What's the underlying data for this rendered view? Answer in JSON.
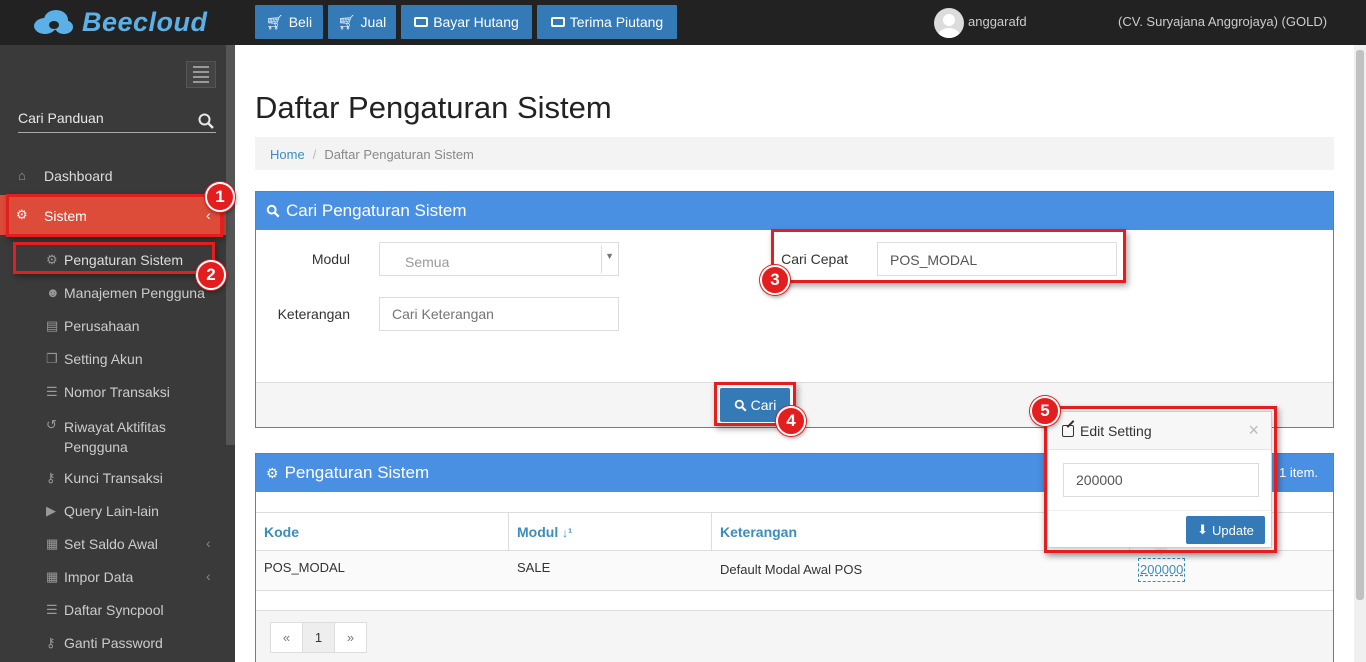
{
  "app": {
    "name": "Beecloud"
  },
  "topnav": {
    "buttons": [
      {
        "label": "Beli",
        "icon": "cart-icon"
      },
      {
        "label": "Jual",
        "icon": "cart-icon"
      },
      {
        "label": "Bayar Hutang",
        "icon": "money-icon"
      },
      {
        "label": "Terima Piutang",
        "icon": "money-icon"
      }
    ],
    "user": "anggarafd",
    "company": "(CV. Suryajana Anggrojaya) (GOLD)"
  },
  "sidebar": {
    "search_placeholder": "Cari Panduan",
    "items": [
      {
        "label": "Dashboard",
        "icon": "home-icon"
      },
      {
        "label": "Sistem",
        "icon": "gears-icon",
        "active": true
      },
      {
        "label": "Pengaturan Sistem",
        "icon": "gear-icon",
        "sub": true
      },
      {
        "label": "Manajemen Pengguna",
        "icon": "users-icon",
        "sub": true
      },
      {
        "label": "Perusahaan",
        "icon": "clipboard-icon",
        "sub": true
      },
      {
        "label": "Setting Akun",
        "icon": "copy-icon",
        "sub": true
      },
      {
        "label": "Nomor Transaksi",
        "icon": "list-icon",
        "sub": true
      },
      {
        "label": "Riwayat Aktifitas Pengguna",
        "icon": "history-icon",
        "sub": true
      },
      {
        "label": "Kunci Transaksi",
        "icon": "key-icon",
        "sub": true
      },
      {
        "label": "Query Lain-lain",
        "icon": "play-icon",
        "sub": true
      },
      {
        "label": "Set Saldo Awal",
        "icon": "table-icon",
        "sub": true
      },
      {
        "label": "Impor Data",
        "icon": "table-icon",
        "sub": true
      },
      {
        "label": "Daftar Syncpool",
        "icon": "list-icon",
        "sub": true
      },
      {
        "label": "Ganti Password",
        "icon": "key-icon",
        "sub": true
      }
    ]
  },
  "page": {
    "title": "Daftar Pengaturan Sistem",
    "breadcrumb": [
      "Home",
      "Daftar Pengaturan Sistem"
    ]
  },
  "search_panel": {
    "title": "Cari Pengaturan Sistem",
    "modul_label": "Modul",
    "modul_value": "Semua",
    "keterangan_label": "Keterangan",
    "keterangan_placeholder": "Cari Keterangan",
    "cari_cepat_label": "Cari Cepat",
    "cari_cepat_value": "POS_MODAL",
    "search_button": "Cari"
  },
  "results_panel": {
    "title": "Pengaturan Sistem",
    "count_text": "1 item.",
    "columns": [
      "Kode",
      "Modul",
      "Keterangan"
    ],
    "rows": [
      {
        "kode": "POS_MODAL",
        "modul": "SALE",
        "keterangan": "Default Modal Awal POS",
        "value": "200000"
      }
    ],
    "pagination": [
      "«",
      "1",
      "»"
    ]
  },
  "popover": {
    "title": "Edit Setting",
    "value": "200000",
    "update_button": "Update"
  },
  "annotations": [
    "1",
    "2",
    "3",
    "4",
    "5"
  ],
  "colors": {
    "accent": "#4a90e2",
    "annotation": "#e41e1e",
    "sidebar_active": "#dd4b39",
    "topbar": "#222222"
  }
}
